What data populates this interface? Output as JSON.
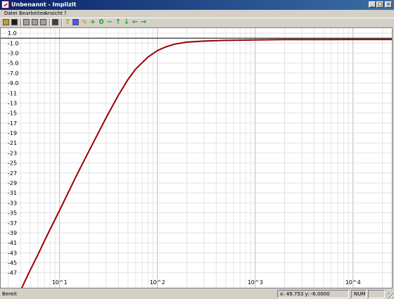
{
  "window": {
    "title": "Unbenannt - Implizit",
    "minimize_glyph": "_",
    "maximize_glyph": "□",
    "close_glyph": "×"
  },
  "menu": [
    {
      "label": "Datei"
    },
    {
      "label": "Bearbeiten"
    },
    {
      "label": "Ansicht"
    },
    {
      "label": "?"
    }
  ],
  "toolbar": [
    {
      "name": "open-folder-icon",
      "color": "#c89a28"
    },
    {
      "name": "save-disk-icon",
      "color": "#1a1a1a"
    },
    {
      "name": "sep"
    },
    {
      "name": "cut-scissors-icon",
      "color": "#a0a0a0"
    },
    {
      "name": "copy-icon",
      "color": "#a0a0a0"
    },
    {
      "name": "paste-icon",
      "color": "#a0a0a0"
    },
    {
      "name": "sep"
    },
    {
      "name": "print-icon",
      "color": "#404040"
    },
    {
      "name": "sep"
    },
    {
      "name": "help-question-icon",
      "color": "#b8a000"
    },
    {
      "name": "blue-square-icon",
      "color": "#5050ff"
    },
    {
      "name": "graph-line-icon",
      "color": "#c0a000"
    },
    {
      "name": "zoom-plus-icon",
      "color": "#22aa22"
    },
    {
      "name": "zero-icon",
      "color": "#22aa22"
    },
    {
      "name": "zoom-minus-icon",
      "color": "#22aa22"
    },
    {
      "name": "arrow-up-icon",
      "color": "#22aa22"
    },
    {
      "name": "arrow-down-icon",
      "color": "#22aa22"
    },
    {
      "name": "arrow-left-icon",
      "color": "#22aa22"
    },
    {
      "name": "arrow-right-icon",
      "color": "#22aa22"
    }
  ],
  "status": {
    "left": "Bereit",
    "coords": "x: 49.753 y: -6.0000",
    "num": "NUM"
  },
  "chart_data": {
    "type": "line",
    "x_scale": "log",
    "xlim": [
      2.5,
      25000
    ],
    "ylim": [
      -50,
      2
    ],
    "x_ticks": [
      {
        "v": 10,
        "label": "10^1"
      },
      {
        "v": 100,
        "label": "10^2"
      },
      {
        "v": 1000,
        "label": "10^3"
      },
      {
        "v": 10000,
        "label": "10^4"
      }
    ],
    "y_ticks": [
      {
        "v": 1,
        "label": "1.0"
      },
      {
        "v": -1,
        "label": "-1.0"
      },
      {
        "v": -3,
        "label": "-3.0"
      },
      {
        "v": -5,
        "label": "-5.0"
      },
      {
        "v": -7,
        "label": "-7.0"
      },
      {
        "v": -9,
        "label": "-9.0"
      },
      {
        "v": -11,
        "label": "-11"
      },
      {
        "v": -13,
        "label": "-13"
      },
      {
        "v": -15,
        "label": "-15"
      },
      {
        "v": -17,
        "label": "-17"
      },
      {
        "v": -19,
        "label": "-19"
      },
      {
        "v": -21,
        "label": "-21"
      },
      {
        "v": -23,
        "label": "-23"
      },
      {
        "v": -25,
        "label": "-25"
      },
      {
        "v": -27,
        "label": "-27"
      },
      {
        "v": -29,
        "label": "-29"
      },
      {
        "v": -31,
        "label": "-31"
      },
      {
        "v": -33,
        "label": "-33"
      },
      {
        "v": -35,
        "label": "-35"
      },
      {
        "v": -37,
        "label": "-37"
      },
      {
        "v": -39,
        "label": "-39"
      },
      {
        "v": -41,
        "label": "-41"
      },
      {
        "v": -43,
        "label": "-43"
      },
      {
        "v": -45,
        "label": "-45"
      },
      {
        "v": -47,
        "label": "-47"
      }
    ],
    "zero_line": 0,
    "grid": true,
    "series": [
      {
        "color": "#990000",
        "x": [
          4,
          5,
          6,
          7,
          8,
          10,
          12,
          15,
          20,
          25,
          30,
          40,
          50,
          60,
          80,
          100,
          120,
          150,
          200,
          300,
          500,
          1000,
          2000,
          5000,
          10000,
          25000
        ],
        "y": [
          -50.5,
          -46.5,
          -43.4,
          -40.6,
          -38.3,
          -34.5,
          -31.3,
          -27.4,
          -22.6,
          -18.9,
          -15.9,
          -11.4,
          -8.3,
          -6.2,
          -3.8,
          -2.5,
          -1.8,
          -1.2,
          -0.8,
          -0.6,
          -0.45,
          -0.35,
          -0.3,
          -0.28,
          -0.27,
          -0.27
        ]
      }
    ]
  }
}
